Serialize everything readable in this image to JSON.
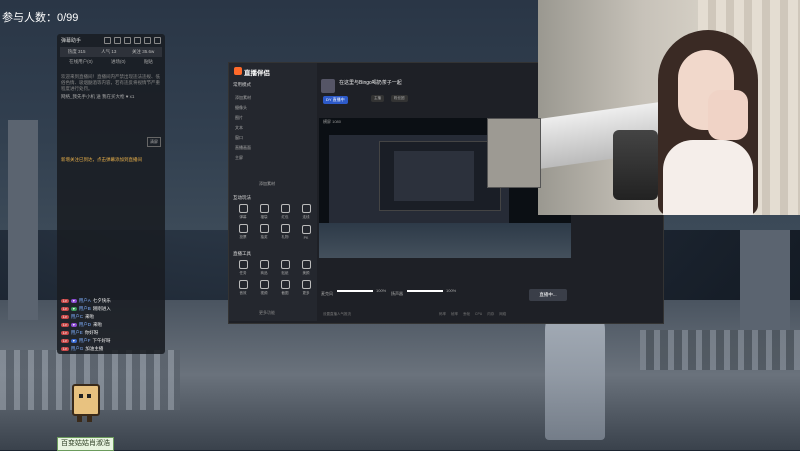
{
  "overlay": {
    "participants": "参与人数：0/99"
  },
  "chat": {
    "title": "弹幕助手",
    "stats": [
      "热度 315",
      "人气 13",
      "关注 35.6w"
    ],
    "tabs": [
      "在线用户(0)",
      "进场(0)",
      "贴贴"
    ],
    "system_lines": [
      "欢迎来到直播间！直播间内严禁出现违法违规、低俗色情、吸烟酗酒等内容，若有违反将视情节严重程度进行处罚。",
      "网络_我先手小机 送 我在买大枪 ♥ x1"
    ],
    "follow_btn": "清屏",
    "highlight": "新增关注已到达，点击弹幕添加到直播间",
    "messages": [
      {
        "user": "用户A",
        "text": "七夕快乐"
      },
      {
        "user": "用户B",
        "text": "刚刚进入"
      },
      {
        "user": "用户C",
        "text": "来啦"
      },
      {
        "user": "用户D",
        "text": "来啦"
      },
      {
        "user": "用户E",
        "text": "你好呀"
      },
      {
        "user": "用户F",
        "text": "下午好呀"
      },
      {
        "user": "用户G",
        "text": "加油主播"
      }
    ]
  },
  "app": {
    "name": "直播伴侣",
    "sub": "常用模式",
    "side_rows": [
      "添加素材",
      "摄像头",
      "图片",
      "文本",
      "窗口",
      "直播画面",
      "主屏",
      "添加素材"
    ],
    "section_interact": "互动玩法",
    "section_tools": "直播工具",
    "interact_items": [
      "弹幕",
      "福袋",
      "红包",
      "连线",
      "投票",
      "抽奖",
      "礼物",
      "PK"
    ],
    "tool_items": [
      "任务",
      "商品",
      "贴纸",
      "美颜",
      "音效",
      "视频",
      "截图",
      "更多"
    ],
    "more": "更多功能",
    "header_title": "在这里与Bingo喝奶茶子一起",
    "header_badge": "DY 直播中",
    "header_chips": [
      "主播",
      "粉丝团"
    ],
    "header_right": "弹幕 礼物 4 ·",
    "header_live": "开播",
    "preview_label": "横屏 1080",
    "mic_label": "麦克风",
    "mic_value": "100%",
    "speaker_label": "扬声器",
    "speaker_value": "100%",
    "start_button": "直播中...",
    "status_left": "设置直播人气推流",
    "status_right": "码率 帧率 丢帧 CPU 内存 网络"
  },
  "mascot": {
    "label": "百变姑姑肖淑浩"
  }
}
